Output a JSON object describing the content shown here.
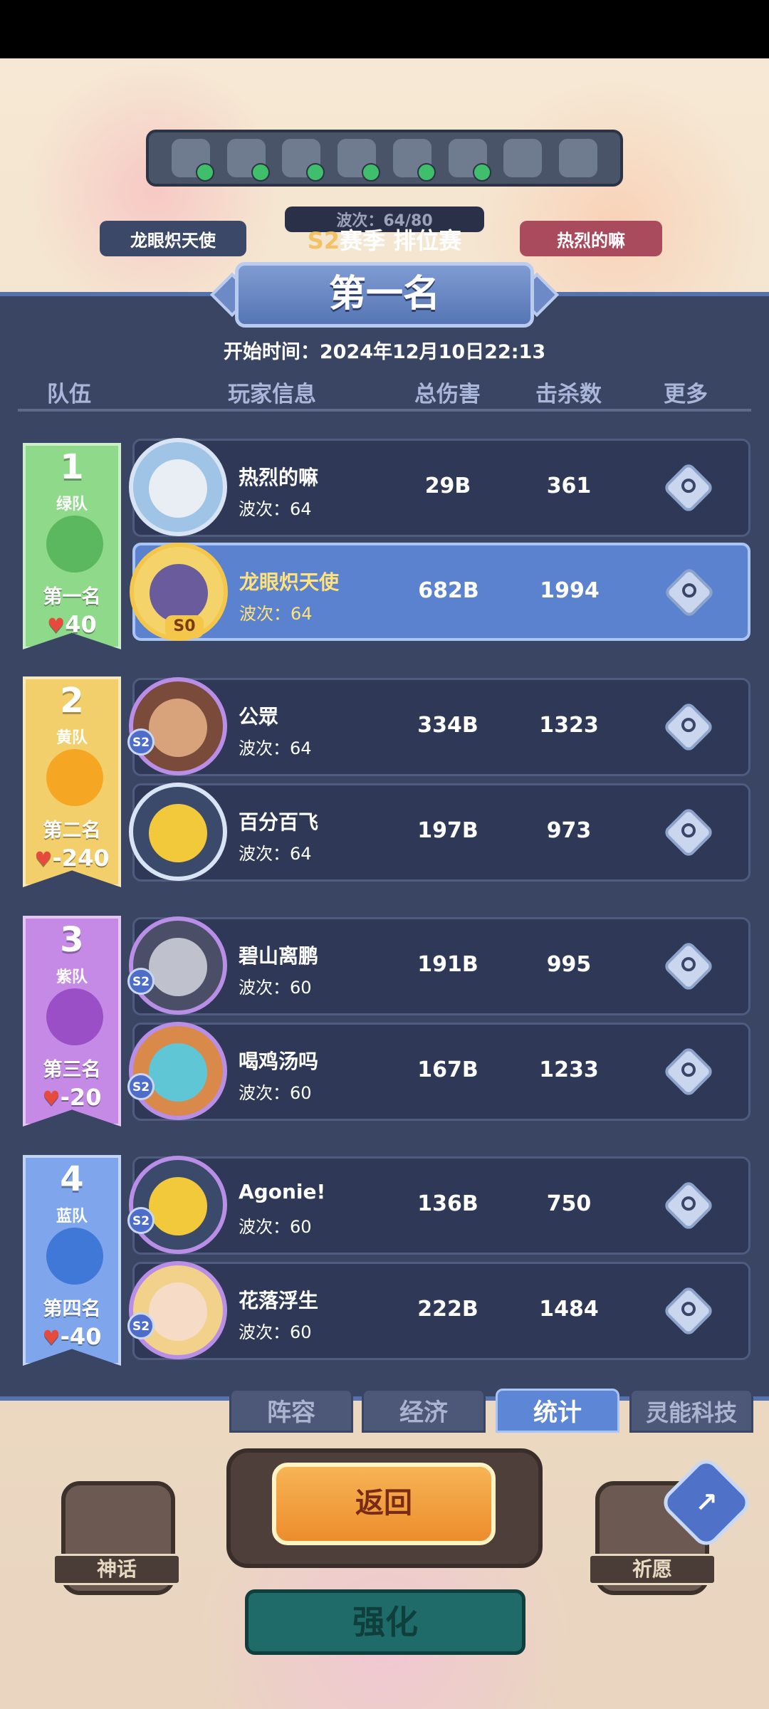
{
  "header": {
    "season_prefix": "S2",
    "season_title": "赛季 排位赛",
    "rank_title": "第一名",
    "start_time": "开始时间：2024年12月10日22:13",
    "left_player_chip": "龙眼炽天使",
    "right_player_chip": "热烈的嘛",
    "wave_chip": "波次：64/80"
  },
  "columns": {
    "team": "队伍",
    "player": "玩家信息",
    "damage": "总伤害",
    "kills": "击杀数",
    "more": "更多"
  },
  "teams": [
    {
      "num": "1",
      "name": "绿队",
      "place": "第一名",
      "hearts": "40",
      "color": "#8fd98a",
      "players": [
        {
          "name": "热烈的嘛",
          "wave": "波次：64",
          "damage": "29B",
          "kills": "361",
          "highlight": false
        },
        {
          "name": "龙眼炽天使",
          "wave": "波次：64",
          "damage": "682B",
          "kills": "1994",
          "highlight": true,
          "tag": "S0"
        }
      ]
    },
    {
      "num": "2",
      "name": "黄队",
      "place": "第二名",
      "hearts": "-240",
      "color": "#f2cf6b",
      "players": [
        {
          "name": "公眾",
          "wave": "波次：64",
          "damage": "334B",
          "kills": "1323",
          "tag": "S2"
        },
        {
          "name": "百分百飞",
          "wave": "波次：64",
          "damage": "197B",
          "kills": "973"
        }
      ]
    },
    {
      "num": "3",
      "name": "紫队",
      "place": "第三名",
      "hearts": "-20",
      "color": "#c58ae6",
      "players": [
        {
          "name": "碧山离鹏",
          "wave": "波次：60",
          "damage": "191B",
          "kills": "995",
          "tag": "S2"
        },
        {
          "name": "喝鸡汤吗",
          "wave": "波次：60",
          "damage": "167B",
          "kills": "1233",
          "tag": "S2"
        }
      ]
    },
    {
      "num": "4",
      "name": "蓝队",
      "place": "第四名",
      "hearts": "-40",
      "color": "#7fa6ec",
      "players": [
        {
          "name": "Agonie!",
          "wave": "波次：60",
          "damage": "136B",
          "kills": "750",
          "tag": "S2"
        },
        {
          "name": "花落浮生",
          "wave": "波次：60",
          "damage": "222B",
          "kills": "1484",
          "tag": "S2"
        }
      ]
    }
  ],
  "tabs": [
    {
      "label": "阵容",
      "active": false
    },
    {
      "label": "经济",
      "active": false
    },
    {
      "label": "统计",
      "active": true
    },
    {
      "label": "灵能科技",
      "active": false
    }
  ],
  "buttons": {
    "back": "返回",
    "upgrade": "强化",
    "myth": "神话",
    "wish": "祈愿"
  },
  "colors": {
    "panel": "#3a4463",
    "highlight_row": "#5b82cf",
    "back_button": "#ec8d2c"
  }
}
